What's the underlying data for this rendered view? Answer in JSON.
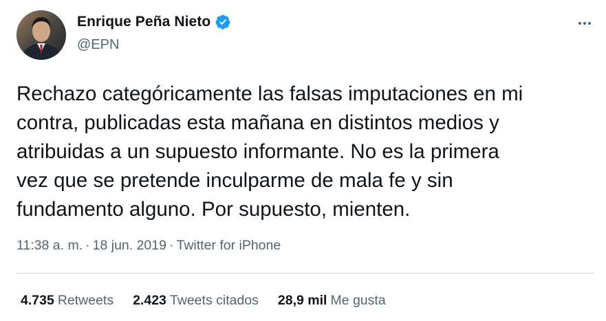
{
  "author": {
    "display_name": "Enrique Peña Nieto",
    "handle": "@EPN",
    "verified": true
  },
  "tweet": {
    "text": "Rechazo categóricamente las falsas imputaciones en mi\ncontra, publicadas esta mañana en distintos medios y\natribuidas a un supuesto informante. No es la primera\nvez que se pretende inculparme de mala fe y sin\nfundamento alguno. Por supuesto, mienten.",
    "time": "11:38 a. m.",
    "separator": "·",
    "date": "18 jun. 2019",
    "source": "Twitter for iPhone"
  },
  "stats": {
    "retweets_count": "4.735",
    "retweets_label": "Retweets",
    "quotes_count": "2.423",
    "quotes_label": "Tweets citados",
    "likes_count": "28,9 mil",
    "likes_label": "Me gusta"
  },
  "colors": {
    "verified": "#1d9bf0",
    "secondary_text": "#536471",
    "primary_text": "#0f1419",
    "divider": "#cfd9de"
  },
  "icons": {
    "verified": "verified-badge-icon",
    "more": "more-options-icon"
  }
}
